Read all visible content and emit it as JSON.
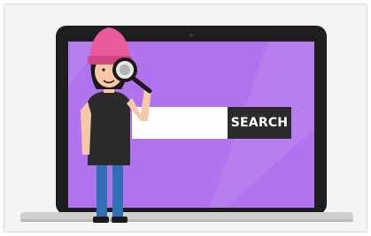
{
  "search": {
    "button_label": "SEARCH",
    "input_value": ""
  },
  "illustration": {
    "subject": "person-with-magnifying-glass",
    "device": "laptop"
  },
  "colors": {
    "screen": "#b173ee",
    "laptop_bezel": "#1e1e1e",
    "laptop_base": "#cfcfcf",
    "hat": "#e85a9a",
    "shirt": "#2b2b2b",
    "pants": "#2f6fb3",
    "skin": "#f6c8a8",
    "hair": "#1a1a1a",
    "search_button": "#2b2b2b"
  },
  "icons": [
    "magnifying-glass-icon"
  ]
}
